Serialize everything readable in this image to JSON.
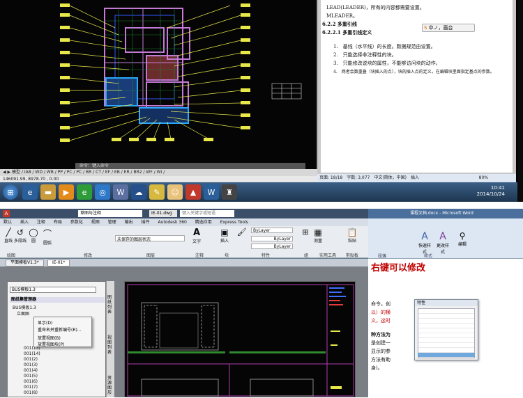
{
  "top": {
    "cad": {
      "command_prompt": "命令：键入命令",
      "layout_tabs": "◀ ▶ 模型 / IA8 / WD / WB / PP / PC / PC / BR / CT / EF / EB / ER / BR2 / WF / WI /",
      "coords": "146091.99, 8978.70 , 0.00",
      "colors": {
        "background": "#050505",
        "wall": "#c47ad6",
        "label_line": "#e8e84a"
      }
    },
    "word": {
      "lines": [
        "LEAD(LEADER)，所有的内容都需要设置。",
        "MLEADER。",
        "6.2.2 多重引线",
        "6.2.2.1 多重引线定义",
        "1.　基线（水平线）的长度。数据规范由设置。",
        "2.　只能选择非注释性的块。",
        "3.　只能修改说块的属性，不能够访问块的动作。",
        "4.　两者会数重叠（块插入的点），块的插入点的定义，在编辑块里面指定基点的参数。"
      ],
      "status_bar": "页面: 18/18　字数: 3,077　中文(简体，中国)　插入",
      "zoom": "80%"
    },
    "ime_label": "中ノ，画台",
    "clock": {
      "time": "10:41",
      "date": "2014/10/24"
    }
  },
  "bottom": {
    "acad": {
      "workspace": "草图与注释",
      "file_title": "IE-01.dwg",
      "search_placeholder": "键入关键字或短语",
      "ribbon_tabs": [
        "默认",
        "插入",
        "注释",
        "布局",
        "参数化",
        "视图",
        "管理",
        "输出",
        "插件",
        "Autodesk 360",
        "精选应用",
        "Express Tools"
      ],
      "draw_buttons": [
        "直线",
        "多段线",
        "圆",
        "圆弧"
      ],
      "layer_state": "未保存的图层状态",
      "group_labels": [
        "绘图",
        "修改",
        "图层",
        "注释",
        "块",
        "特性",
        "组",
        "实用工具",
        "剪贴板"
      ],
      "big_buttons": [
        "文字",
        "插入",
        "特性匹配",
        "组",
        "测量",
        "粘贴"
      ],
      "properties": [
        "ByLayer",
        "ByLayer",
        "ByLayer"
      ],
      "doc_tabs": [
        "平面模板V1.3*",
        "IE-01*"
      ],
      "sheet_set": {
        "combo": "BUS模板1.3",
        "header": "图纸集管理器",
        "tree": [
          "BUS模板1.3",
          "立面图",
          "001(13)",
          "001(14)",
          "001(2)",
          "001(3)",
          "001(4)",
          "001(5)",
          "001(6)",
          "001(7)",
          "001(8)"
        ],
        "context_menu": [
          "显示(D)",
          "重命名并重新编号(R)...",
          "放置视图(B)",
          "放置视图块(P)"
        ]
      },
      "side_tabs": [
        "图纸列表",
        "视图列表",
        "资源图形"
      ]
    },
    "word": {
      "title": "课程文档.docx - Microsoft Word",
      "ribbon_groups": [
        "段落",
        "样式"
      ],
      "style_buttons": [
        "快速样式",
        "更改样式",
        "编辑"
      ],
      "lines": [
        "右键可以修改",
        "命令。创",
        "以）的横",
        "义，这时",
        "种方法为",
        "是创建一",
        "显示的参",
        "方法有助",
        "身)。"
      ],
      "dialog_title": "特性"
    }
  }
}
